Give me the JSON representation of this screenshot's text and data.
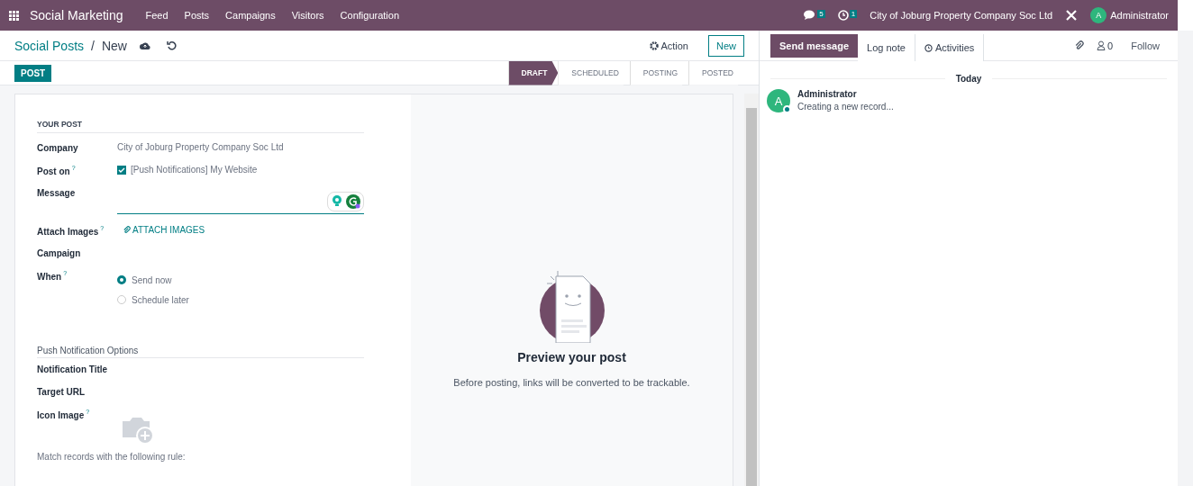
{
  "navbar": {
    "app_name": "Social Marketing",
    "menu": [
      "Feed",
      "Posts",
      "Campaigns",
      "Visitors",
      "Configuration"
    ],
    "messages_count": "5",
    "activities_count": "1",
    "company": "City of Joburg Property Company Soc Ltd",
    "user_initial": "A",
    "user": "Administrator"
  },
  "breadcrumb": {
    "parent": "Social Posts",
    "separator": "/",
    "current": "New"
  },
  "actions": {
    "action": "Action",
    "new": "New"
  },
  "post_button": "POST",
  "stages": [
    {
      "label": "DRAFT",
      "selected": true
    },
    {
      "label": "SCHEDULED",
      "selected": false
    },
    {
      "label": "POSTING",
      "selected": false
    },
    {
      "label": "POSTED",
      "selected": false
    }
  ],
  "form": {
    "section": "YOUR POST",
    "fields": [
      {
        "kind": "text",
        "label": "Company",
        "value": "City of Joburg Property Company Soc Ltd"
      },
      {
        "kind": "checkbox",
        "label": "Post on",
        "help": "?",
        "value": "[Push Notifications] My Website",
        "checked": true
      },
      {
        "kind": "message",
        "label": "Message"
      },
      {
        "kind": "attach",
        "label": "Attach Images",
        "help": "?",
        "value": "ATTACH IMAGES"
      },
      {
        "kind": "empty",
        "label": "Campaign"
      },
      {
        "kind": "radio",
        "label": "When",
        "help": "?",
        "options": [
          {
            "label": "Send now",
            "selected": true
          },
          {
            "label": "Schedule later",
            "selected": false
          }
        ]
      }
    ],
    "push_section": "Push Notification Options",
    "push_fields": [
      {
        "kind": "empty",
        "label": "Notification Title"
      },
      {
        "kind": "empty",
        "label": "Target URL"
      },
      {
        "kind": "image",
        "label": "Icon Image",
        "help": "?"
      }
    ],
    "rule_text": "Match records with the following rule:"
  },
  "preview": {
    "title": "Preview your post",
    "text": "Before posting, links will be converted to be trackable."
  },
  "chatter": {
    "tabs": [
      {
        "label": "Send message",
        "selected": true
      },
      {
        "label": "Log note",
        "selected": false
      },
      {
        "label": "Activities",
        "selected": false
      }
    ],
    "followers": "0",
    "follow": "Follow",
    "day": "Today",
    "messages": [
      {
        "initial": "A",
        "author": "Administrator",
        "text": "Creating a new record..."
      }
    ]
  }
}
